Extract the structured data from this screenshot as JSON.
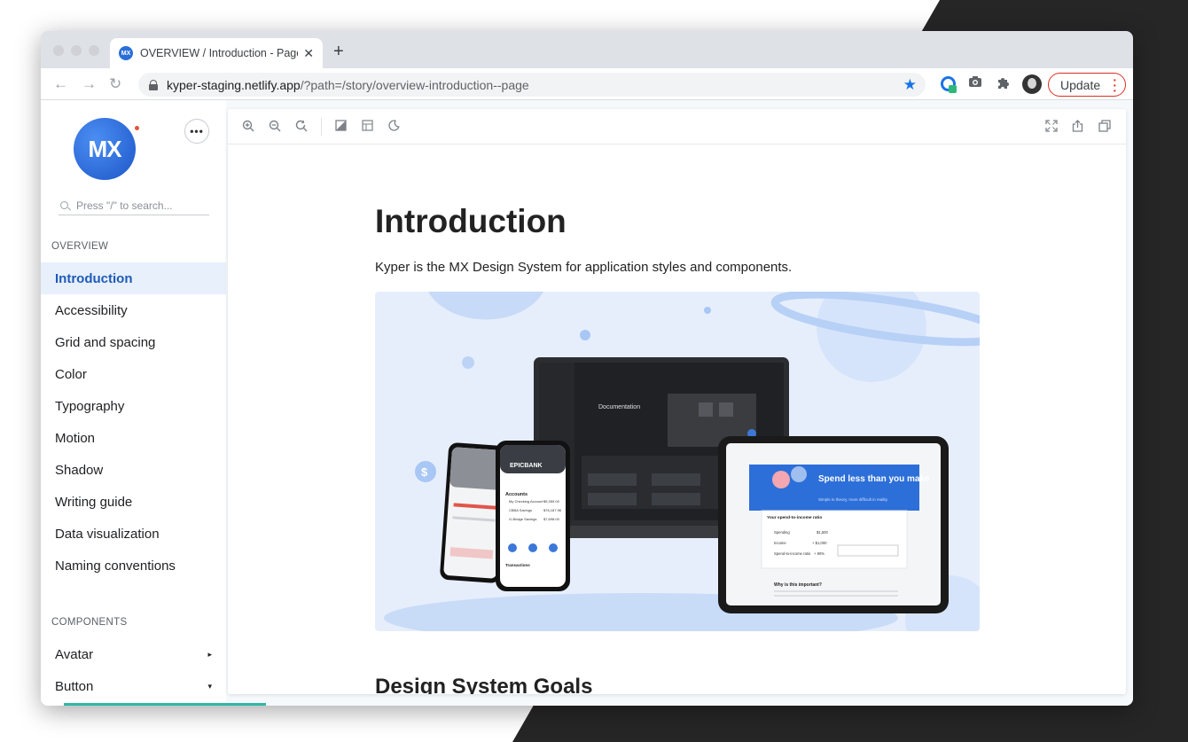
{
  "browser": {
    "tab_title": "OVERVIEW / Introduction - Page",
    "tab_favicon_text": "MX",
    "url_host": "kyper-staging.netlify.app",
    "url_path": "/?path=/story/overview-introduction--page",
    "update_label": "Update"
  },
  "sidebar": {
    "logo_text": "MX",
    "more_label": "•••",
    "search_placeholder": "Press \"/\" to search...",
    "overview_label": "OVERVIEW",
    "overview_items": [
      {
        "label": "Introduction",
        "active": true
      },
      {
        "label": "Accessibility"
      },
      {
        "label": "Grid and spacing"
      },
      {
        "label": "Color"
      },
      {
        "label": "Typography"
      },
      {
        "label": "Motion"
      },
      {
        "label": "Shadow"
      },
      {
        "label": "Writing guide"
      },
      {
        "label": "Data visualization"
      },
      {
        "label": "Naming conventions"
      }
    ],
    "components_label": "COMPONENTS",
    "component_items": [
      {
        "label": "Avatar",
        "caret": "▸"
      },
      {
        "label": "Button",
        "caret": "▾"
      }
    ]
  },
  "main": {
    "title": "Introduction",
    "lead": "Kyper is the MX Design System for application styles and components.",
    "section_heading": "Design System Goals",
    "hero": {
      "laptop_doc_title": "Documentation",
      "tablet_headline": "Spend less than you make",
      "tablet_subline": "Simple in theory, more difficult in reality.",
      "tablet_card_title": "Your spend-to-income ratio",
      "tablet_rows": [
        {
          "label": "Spending",
          "value": "$1,500"
        },
        {
          "label": "Income",
          "value": "+ $1,000"
        },
        {
          "label": "Spend-to-income ratio",
          "value": "+ 90%"
        }
      ],
      "tablet_section": "Why is this important?",
      "phone_brand": "EPICBANK",
      "phone_section": "Accounts",
      "phone_accounts": [
        {
          "name": "My Checking Account",
          "value": "$5,359.00"
        },
        {
          "name": "CBBA Savings",
          "value": "$76,187.96"
        },
        {
          "name": "G-Bridge Savings",
          "value": "$7,698.00"
        }
      ],
      "phone_transactions": "Transactions"
    }
  },
  "colors": {
    "accent": "#1e5bb8",
    "active_bg": "#e8f0fc",
    "update_red": "#d93025",
    "star_blue": "#1a73e8"
  }
}
